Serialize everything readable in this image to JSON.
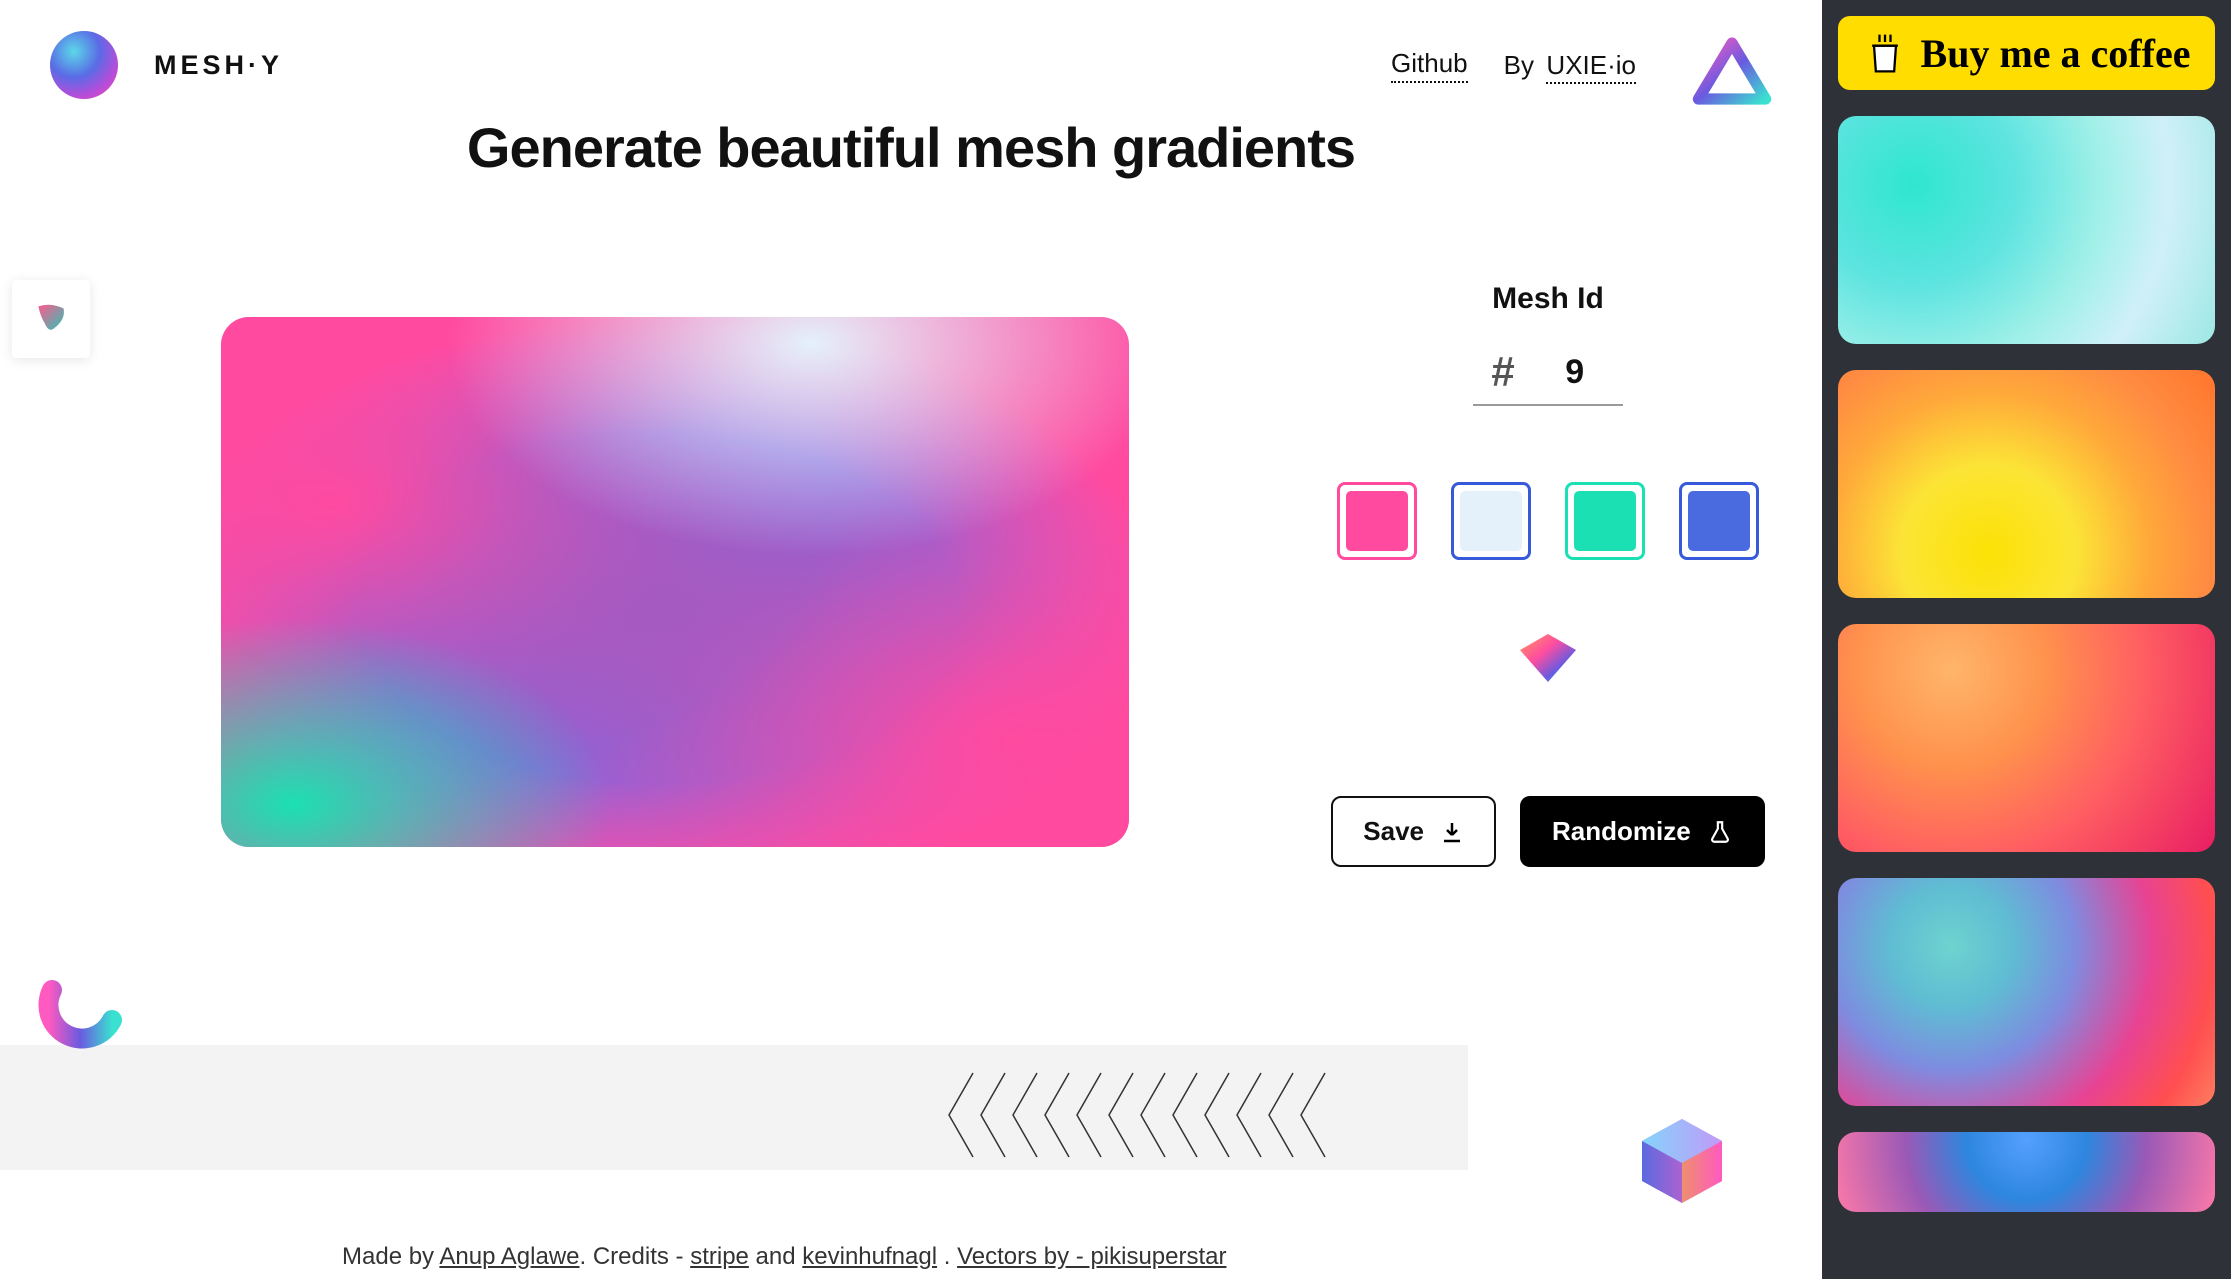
{
  "header": {
    "logo_text": "MESH·Y",
    "github_label": "Github",
    "by_label": "By",
    "uxie_label": "UXIE·io"
  },
  "page_title": "Generate beautiful mesh gradients",
  "mesh": {
    "id_label": "Mesh Id",
    "hash": "#",
    "id_value": "9",
    "colors": [
      {
        "border": "#ff4aa0",
        "fill": "#ff4aa0"
      },
      {
        "border": "#375adb",
        "fill": "#e4f1fb"
      },
      {
        "border": "#1ae0b3",
        "fill": "#1ae0b3"
      },
      {
        "border": "#375adb",
        "fill": "#4a6ae0"
      }
    ]
  },
  "actions": {
    "save_label": "Save",
    "randomize_label": "Randomize"
  },
  "sidebar": {
    "coffee_label": "Buy me a coffee"
  },
  "footer": {
    "made_by_prefix": "Made by ",
    "author": "Anup Aglawe",
    "credits_prefix": ". Credits - ",
    "stripe": "stripe",
    "and": " and ",
    "kevin": "kevinhufnagl",
    "dot": " . ",
    "vectors": "Vectors by - pikisuperstar"
  }
}
